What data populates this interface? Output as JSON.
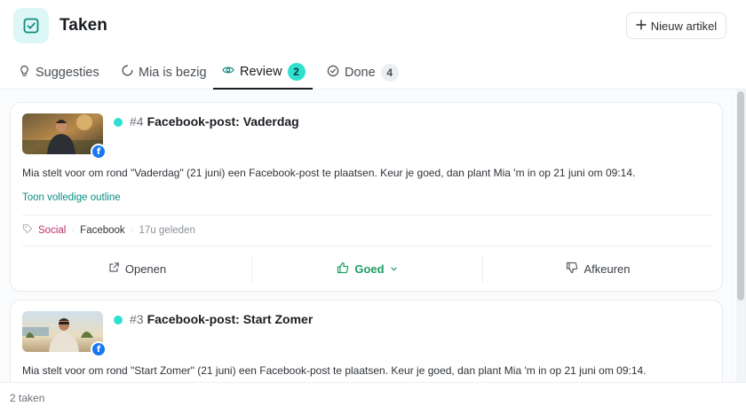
{
  "header": {
    "icon": "checkbox-square-icon",
    "title": "Taken",
    "new_button": {
      "icon": "plus-icon",
      "label": "Nieuw artikel"
    }
  },
  "tabs": [
    {
      "label": "Suggesties",
      "icon": "lightbulb-icon"
    },
    {
      "label": "Mia is bezig",
      "icon": "spinner-icon"
    },
    {
      "label": "Review",
      "icon": "eye-icon",
      "count": "2",
      "active": true
    },
    {
      "label": "Done",
      "icon": "check-circle-icon",
      "count": "4"
    }
  ],
  "colors": {
    "accent": "#2ee0cf",
    "accent_dark": "#0a8f84",
    "link": "#0a8f84",
    "tag": "#c2306b",
    "approve": "#1e9e62",
    "facebook": "#1877f2"
  },
  "cards": [
    {
      "number": "#4",
      "title": "Facebook-post: Vaderdag",
      "platform_badge": "facebook-icon",
      "description": "Mia stelt voor om rond \"Vaderdag\" (21 juni) een Facebook-post te plaatsen. Keur je goed, dan plant Mia 'm in op 21 juni om 09:14.",
      "outline_link": "Toon volledige outline",
      "meta": {
        "tag": "Social",
        "platform": "Facebook",
        "time": "17u geleden"
      },
      "actions": {
        "open": "Openen",
        "approve": "Goed",
        "reject": "Afkeuren"
      }
    },
    {
      "number": "#3",
      "title": "Facebook-post: Start Zomer",
      "platform_badge": "facebook-icon",
      "description": "Mia stelt voor om rond \"Start Zomer\" (21 juni) een Facebook-post te plaatsen. Keur je goed, dan plant Mia 'm in op 21 juni om 09:14."
    }
  ],
  "footer": {
    "count": "2 taken"
  }
}
